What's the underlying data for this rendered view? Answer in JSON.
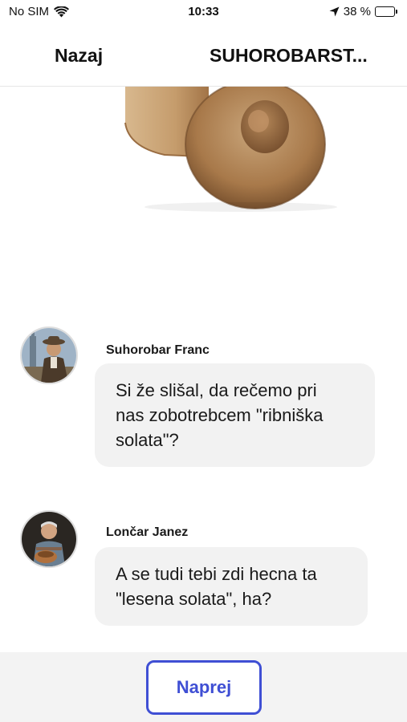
{
  "status_bar": {
    "carrier": "No SIM",
    "time": "10:33",
    "battery": "38 %",
    "battery_level": 0.38
  },
  "nav": {
    "back_label": "Nazaj",
    "title": "SUHOROBARST..."
  },
  "hero_image": {
    "icon": "wooden-object-image"
  },
  "messages": [
    {
      "sender": "Suhorobar Franc",
      "text_lines": [
        "Si že slišal, da rečemo pri",
        "nas zobotrebcem \"ribniška",
        "solata\"?"
      ]
    },
    {
      "sender": "Lončar Janez",
      "text_lines": [
        "A se tudi tebi zdi hecna ta",
        "\"lesena solata\", ha?"
      ]
    }
  ],
  "footer": {
    "next_label": "Naprej"
  },
  "colors": {
    "accent": "#3f4fd4",
    "bubble": "#f2f2f2",
    "footer": "#f3f3f3"
  }
}
